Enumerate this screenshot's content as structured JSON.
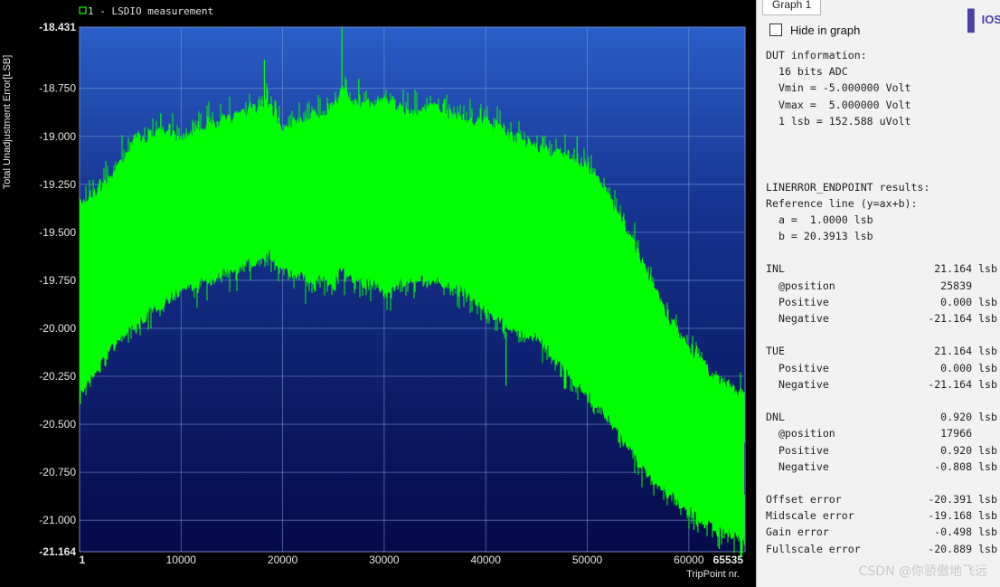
{
  "chart_data": {
    "type": "line",
    "title": "1 - LSDIO measurement",
    "xlabel": "TripPoint nr.",
    "ylabel": "Total Unadjustment Error[LSB]",
    "xlim": [
      1,
      65535
    ],
    "ylim": [
      -21.164,
      -18.431
    ],
    "x_ticks": [
      "1",
      "10000",
      "20000",
      "30000",
      "40000",
      "50000",
      "60000",
      "65535"
    ],
    "y_ticks": [
      "-18.431",
      "-18.750",
      "-19.000",
      "-19.250",
      "-19.500",
      "-19.750",
      "-20.000",
      "-20.250",
      "-20.500",
      "-20.750",
      "-21.000",
      "-21.164"
    ],
    "grid": true,
    "series": [
      {
        "name": "1 - LSDIO measurement",
        "color": "#00ff00",
        "x": [
          1,
          2500,
          5000,
          7500,
          10000,
          12500,
          15000,
          17500,
          18500,
          20000,
          22500,
          25000,
          25839,
          27500,
          30000,
          32500,
          35000,
          37500,
          40000,
          42500,
          45000,
          47500,
          50000,
          52500,
          55000,
          57500,
          60000,
          62500,
          65535
        ],
        "upper": [
          -19.35,
          -19.25,
          -19.05,
          -18.98,
          -19.0,
          -18.95,
          -18.9,
          -18.85,
          -18.82,
          -18.95,
          -18.9,
          -18.85,
          -18.75,
          -18.85,
          -18.8,
          -18.88,
          -18.85,
          -18.9,
          -18.92,
          -19.0,
          -19.05,
          -19.1,
          -19.15,
          -19.35,
          -19.6,
          -19.9,
          -20.1,
          -20.25,
          -20.35
        ],
        "lower": [
          -20.35,
          -20.15,
          -20.0,
          -19.9,
          -19.8,
          -19.75,
          -19.7,
          -19.65,
          -19.6,
          -19.7,
          -19.75,
          -19.75,
          -19.7,
          -19.75,
          -19.8,
          -19.75,
          -19.75,
          -19.8,
          -19.9,
          -20.0,
          -20.05,
          -20.2,
          -20.35,
          -20.5,
          -20.7,
          -20.85,
          -20.95,
          -21.05,
          -21.1
        ]
      }
    ]
  },
  "panel": {
    "tab_label": "Graph 1",
    "logo_text": "IOS",
    "hide_label": "Hide in graph",
    "lines": [
      {
        "l": "DUT information:",
        "v": ""
      },
      {
        "l": "  16 bits ADC",
        "v": ""
      },
      {
        "l": "  Vmin = -5.000000 Volt",
        "v": ""
      },
      {
        "l": "  Vmax =  5.000000 Volt",
        "v": ""
      },
      {
        "l": "  1 lsb = 152.588 uVolt",
        "v": ""
      },
      {
        "gap": true
      },
      {
        "gap": true
      },
      {
        "gap": true
      },
      {
        "l": "LINERROR_ENDPOINT results:",
        "v": ""
      },
      {
        "l": "Reference line (y=ax+b):",
        "v": ""
      },
      {
        "l": "  a =  1.0000 lsb",
        "v": ""
      },
      {
        "l": "  b = 20.3913 lsb",
        "v": ""
      },
      {
        "gap": true
      },
      {
        "l": "INL",
        "v": "21.164 lsb"
      },
      {
        "l": "  @position",
        "v": "25839    "
      },
      {
        "l": "  Positive",
        "v": "0.000 lsb"
      },
      {
        "l": "  Negative",
        "v": "-21.164 lsb"
      },
      {
        "gap": true
      },
      {
        "l": "TUE",
        "v": "21.164 lsb"
      },
      {
        "l": "  Positive",
        "v": "0.000 lsb"
      },
      {
        "l": "  Negative",
        "v": "-21.164 lsb"
      },
      {
        "gap": true
      },
      {
        "l": "DNL",
        "v": "0.920 lsb"
      },
      {
        "l": "  @position",
        "v": "17966    "
      },
      {
        "l": "  Positive",
        "v": "0.920 lsb"
      },
      {
        "l": "  Negative",
        "v": "-0.808 lsb"
      },
      {
        "gap": true
      },
      {
        "l": "Offset error",
        "v": "-20.391 lsb"
      },
      {
        "l": "Midscale error",
        "v": "-19.168 lsb"
      },
      {
        "l": "Gain error",
        "v": "-0.498 lsb"
      },
      {
        "l": "Fullscale error",
        "v": "-20.889 lsb"
      }
    ],
    "watermark": "CSDN @你骄傲地飞远"
  }
}
